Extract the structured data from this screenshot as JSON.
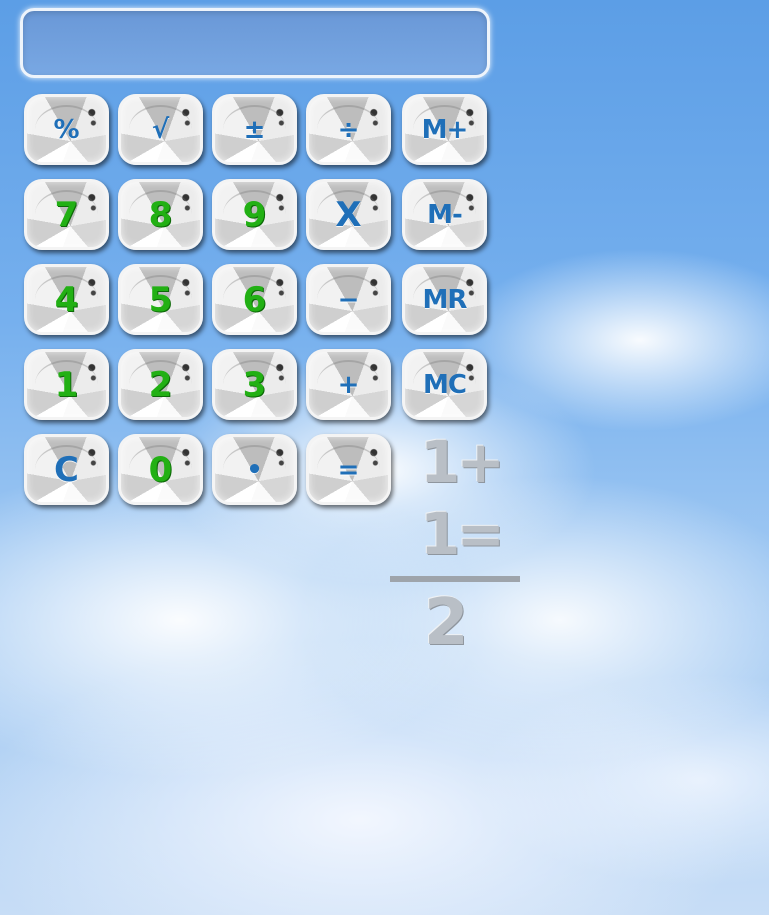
{
  "display": {
    "value": ""
  },
  "keypad": {
    "rows": [
      [
        {
          "label": "%",
          "color": "blue",
          "name": "percent-key"
        },
        {
          "label": "√",
          "color": "blue",
          "name": "sqrt-key"
        },
        {
          "label": "±",
          "color": "blue",
          "name": "plus-minus-key"
        },
        {
          "label": "÷",
          "color": "blue",
          "name": "divide-key"
        },
        {
          "label": "M+",
          "color": "blue",
          "name": "memory-add-key"
        }
      ],
      [
        {
          "label": "7",
          "color": "green",
          "name": "digit-7-key"
        },
        {
          "label": "8",
          "color": "green",
          "name": "digit-8-key"
        },
        {
          "label": "9",
          "color": "green",
          "name": "digit-9-key"
        },
        {
          "label": "X",
          "color": "blue",
          "name": "multiply-key"
        },
        {
          "label": "M-",
          "color": "blue",
          "name": "memory-subtract-key"
        }
      ],
      [
        {
          "label": "4",
          "color": "green",
          "name": "digit-4-key"
        },
        {
          "label": "5",
          "color": "green",
          "name": "digit-5-key"
        },
        {
          "label": "6",
          "color": "green",
          "name": "digit-6-key"
        },
        {
          "label": "−",
          "color": "blue",
          "name": "minus-key"
        },
        {
          "label": "MR",
          "color": "blue",
          "name": "memory-recall-key"
        }
      ],
      [
        {
          "label": "1",
          "color": "green",
          "name": "digit-1-key"
        },
        {
          "label": "2",
          "color": "green",
          "name": "digit-2-key"
        },
        {
          "label": "3",
          "color": "green",
          "name": "digit-3-key"
        },
        {
          "label": "+",
          "color": "blue",
          "name": "plus-key"
        },
        {
          "label": "MC",
          "color": "blue",
          "name": "memory-clear-key"
        }
      ],
      [
        {
          "label": "C",
          "color": "blue",
          "name": "clear-key"
        },
        {
          "label": "0",
          "color": "green",
          "name": "digit-0-key"
        },
        {
          "label": "•",
          "color": "blue",
          "name": "decimal-key"
        },
        {
          "label": "=",
          "color": "blue",
          "name": "equals-key"
        }
      ]
    ]
  },
  "logo": {
    "line1": "1+",
    "line2": "1=",
    "result": "2"
  },
  "colors": {
    "blue": "#1f6fb8",
    "green": "#22b014",
    "logo_gray": "#b9bfc6"
  }
}
